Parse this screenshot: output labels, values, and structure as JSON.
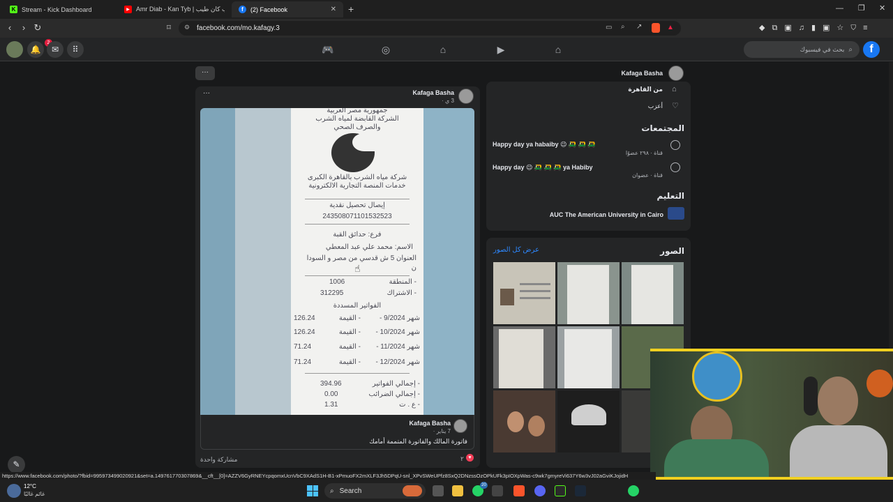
{
  "browser": {
    "tabs": [
      {
        "label": "Stream - Kick Dashboard",
        "active": false
      },
      {
        "label": "Amr Diab - Kan Tyb | دياب كان طيب",
        "active": false
      },
      {
        "label": "(2) Facebook",
        "active": true
      }
    ],
    "url": "facebook.com/mo.kafagy.3"
  },
  "fb": {
    "search_placeholder": "بحث في فيسبوك",
    "notification_badge": "2",
    "profile_more": "···"
  },
  "intro": {
    "name": "Kafaga Basha",
    "from": "من القاهرة",
    "relationship": "أعزب",
    "communities_title": "المجتمعات",
    "communities": [
      {
        "name": "Happy day ya habaiby 😉 🛺 🛺 🛺",
        "meta": "قناة · ٢٩٨ عضوًا"
      },
      {
        "name": "Happy day 😉 🛺 🛺 🛺 ya Habiby",
        "meta": "قناة · عضوان"
      }
    ],
    "education_title": "التعليم",
    "education": "AUC The American University in Cairo"
  },
  "photos": {
    "title": "الصور",
    "see_all": "عرض كل الصور"
  },
  "post": {
    "author": "Kafaga Basha",
    "time": "3 ي ·",
    "more": "···",
    "shared_author": "Kafaga Basha",
    "shared_time": "7 يناير ·",
    "shared_text": "فاتورة المالك والفاتورة المتممة أمامك",
    "shares": "مشاركة واحدة",
    "reactions": "٢"
  },
  "receipt": {
    "header1": "جمهورية مصر العربية",
    "header2": "الشركة القابضة لمياه الشرب",
    "header3": "والصرف الصحي",
    "company1": "شركة مياه الشرب بالقاهرة الكبرى",
    "company2": "خدمات المنصة التجارية الالكترونية",
    "receipt_title": "إيصال تحصيل نقدية",
    "receipt_no": "243508071101532523",
    "branch": "فرع: حدائق القبة",
    "name": "الاسم: محمد علي عبد المعطي",
    "address": "العنوان 5 ش قدسي من مصر و السودا",
    "address2": "ن",
    "zone_label": "- المنطقة",
    "zone": "1006",
    "sub_label": "- الاشتراك",
    "sub": "312295",
    "bills_title": "الفواتير المسددة",
    "bills": [
      {
        "month": "شهر 9/2024 -",
        "value": "126.24",
        "label": "- القيمة"
      },
      {
        "month": "شهر 10/2024 -",
        "value": "126.24",
        "label": "- القيمة"
      },
      {
        "month": "شهر 11/2024 -",
        "value": "71.24",
        "label": "- القيمة"
      },
      {
        "month": "شهر 12/2024 -",
        "value": "71.24",
        "label": "- القيمة"
      }
    ],
    "total_bills_label": "- إجمالي الفواتير",
    "total_bills": "394.96",
    "total_tax_label": "- إجمالي الضرائب",
    "total_tax": "0.00",
    "fee_label": "- ع . ت",
    "fee": "1.31"
  },
  "status_url": "https://www.facebook.com/photo/?fbid=995973499020921&set=a.149761770307869&__cft__[0]=AZZV6GyRNEYcpqomxUcnVbC9XAdS1H-B1-xPmuoFX2mXLF3Jh5DPqU-snl_XPvSWeUPfz8SxQ2DNzssOzOPkUFk3pIOXpWas-c9wk7gmyreVi637Y6w3vJ02aGviKJojidH",
  "taskbar": {
    "temp": "12°C",
    "weather": "غائم غالبًا",
    "search": "Search",
    "badge": "20"
  }
}
